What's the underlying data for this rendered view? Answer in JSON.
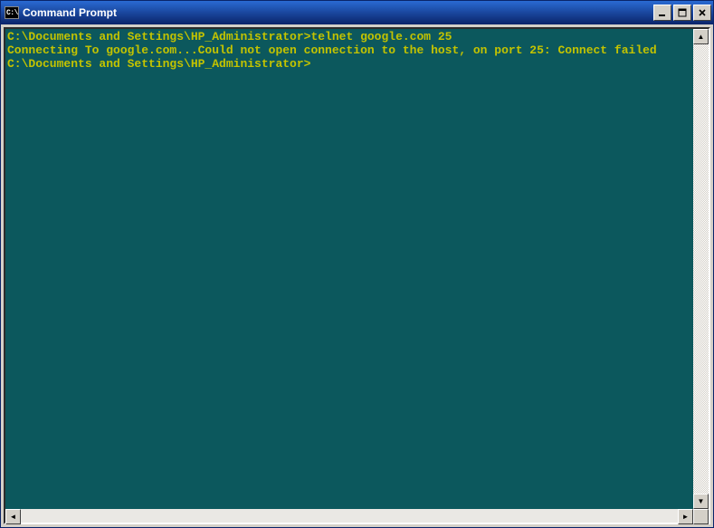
{
  "window": {
    "title": "Command Prompt",
    "sysicon_label": "C:\\"
  },
  "controls": {
    "minimize": "_",
    "maximize": "□",
    "close": "×"
  },
  "console": {
    "lines": [
      "C:\\Documents and Settings\\HP_Administrator>telnet google.com 25",
      "Connecting To google.com...Could not open connection to the host, on port 25: Connect failed",
      "",
      "C:\\Documents and Settings\\HP_Administrator>"
    ]
  },
  "scrollbar": {
    "up": "▲",
    "down": "▼",
    "left": "◄",
    "right": "►"
  }
}
